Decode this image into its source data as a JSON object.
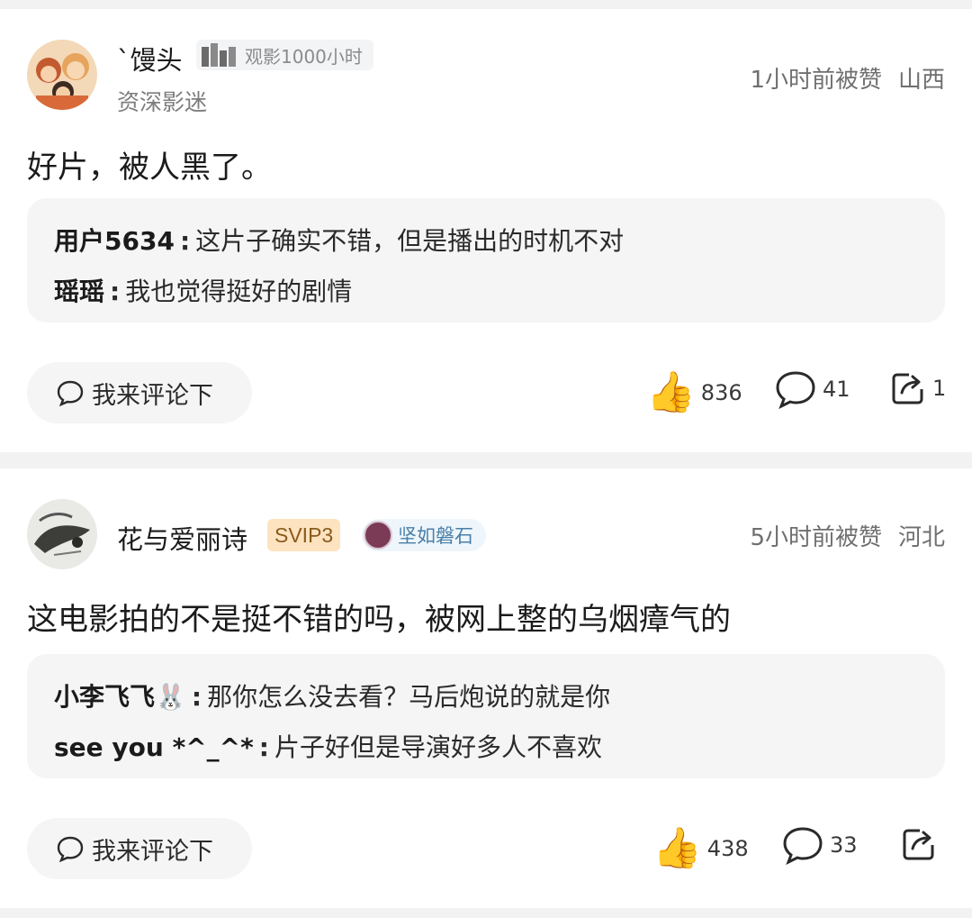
{
  "posts": [
    {
      "username": "`馒头",
      "watch_badge": "观影1000小时",
      "subtitle": "资深影迷",
      "liked_time": "1小时前被赞",
      "location": "山西",
      "content": "好片，被人黑了。",
      "replies": [
        {
          "name": "用户5634",
          "sep": ":",
          "text": "这片子确实不错，但是播出的时机不对"
        },
        {
          "name": "瑶瑶",
          "sep": ":",
          "text": "我也觉得挺好的剧情"
        }
      ],
      "comment_prompt": "我来评论下",
      "likes": "836",
      "comments": "41",
      "shares": "1"
    },
    {
      "username": "花与爱丽诗",
      "vip_badge": "SVIP3",
      "fan_badge": "坚如磐石",
      "liked_time": "5小时前被赞",
      "location": "河北",
      "content": "这电影拍的不是挺不错的吗，被网上整的乌烟瘴气的",
      "replies": [
        {
          "name": "小李飞飞🐰",
          "sep": ":",
          "text": "那你怎么没去看？马后炮说的就是你"
        },
        {
          "name": "see  you  *^_^*",
          "sep": ":",
          "text": "片子好但是导演好多人不喜欢"
        }
      ],
      "comment_prompt": "我来评论下",
      "likes": "438",
      "comments": "33",
      "shares": ""
    }
  ],
  "icons": {
    "like": "thumbs-up-icon",
    "comment": "speech-bubble-icon",
    "share": "share-arrow-icon"
  },
  "colors": {
    "vip_bg": "#fde3bf",
    "vip_text": "#8a5a1d",
    "fan_text": "#4a7fa8",
    "thumb": "#f5b400"
  }
}
